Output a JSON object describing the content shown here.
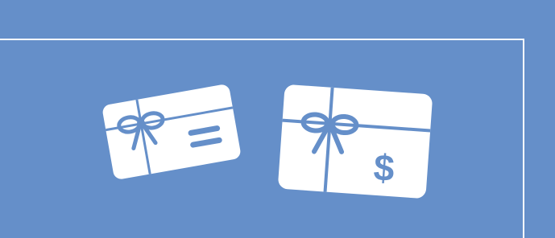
{
  "banner": {
    "background_color": "#658fc9",
    "line_color": "#ffffff",
    "cards": [
      {
        "icon": "gift-card-icon",
        "content": "lines"
      },
      {
        "icon": "gift-card-dollar-icon",
        "symbol": "$"
      }
    ]
  }
}
